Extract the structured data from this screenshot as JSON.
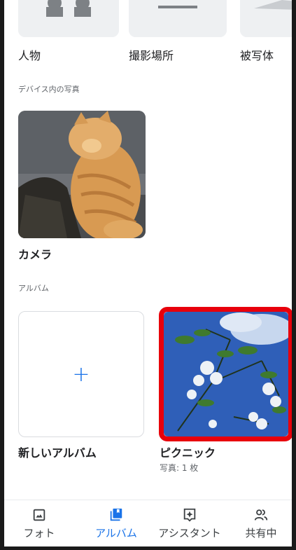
{
  "categories": [
    {
      "label": "人物",
      "icon": "people-thumbnail"
    },
    {
      "label": "撮影場所",
      "icon": "places-thumbnail"
    },
    {
      "label": "被写体",
      "icon": "things-thumbnail"
    }
  ],
  "device_section": {
    "title": "デバイス内の写真",
    "folders": [
      {
        "label": "カメラ",
        "image": "cat-photo"
      }
    ]
  },
  "albums_section": {
    "title": "アルバム",
    "new_album_label": "新しいアルバム",
    "new_album_icon": "plus-icon",
    "albums": [
      {
        "label": "ピクニック",
        "count": "写真: 1 枚",
        "image": "flowers-sky-photo",
        "highlighted": true
      }
    ]
  },
  "bottom_nav": {
    "active": "アルバム",
    "items": [
      {
        "label": "フォト",
        "icon": "photo-icon"
      },
      {
        "label": "アルバム",
        "icon": "album-icon"
      },
      {
        "label": "アシスタント",
        "icon": "assistant-icon"
      },
      {
        "label": "共有中",
        "icon": "sharing-icon"
      }
    ]
  },
  "colors": {
    "accent": "#1a73e8",
    "highlight": "#e8000b"
  }
}
